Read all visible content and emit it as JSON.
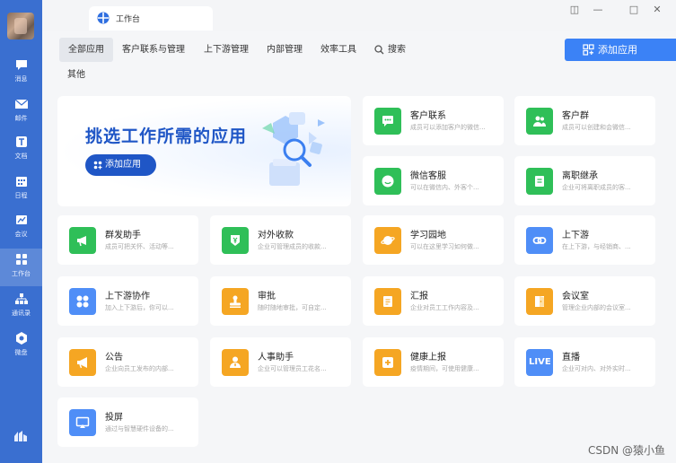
{
  "sidebar": {
    "items": [
      {
        "label": "消息",
        "icon": "chat-icon"
      },
      {
        "label": "邮件",
        "icon": "mail-icon"
      },
      {
        "label": "文档",
        "icon": "doc-icon"
      },
      {
        "label": "日程",
        "icon": "calendar-icon"
      },
      {
        "label": "会议",
        "icon": "meeting-icon"
      },
      {
        "label": "工作台",
        "icon": "grid-icon"
      },
      {
        "label": "通讯录",
        "icon": "contacts-icon"
      },
      {
        "label": "微盘",
        "icon": "drive-icon"
      }
    ],
    "active_index": 5
  },
  "topbar": {
    "tab_label": "工作台"
  },
  "categories": {
    "items": [
      "全部应用",
      "客户联系与管理",
      "上下游管理",
      "内部管理",
      "效率工具",
      "搜索"
    ],
    "other": "其他"
  },
  "add_button": {
    "label": "添加应用"
  },
  "banner": {
    "title": "挑选工作所需的应用",
    "button": "添加应用"
  },
  "apps": [
    {
      "name": "客户联系",
      "desc": "成员可以添加客户的微信...",
      "color": "#2fbf58",
      "icon": "chat-bubble-icon"
    },
    {
      "name": "客户群",
      "desc": "成员可以创建和会微信...",
      "color": "#2fbf58",
      "icon": "people-icon"
    },
    {
      "name": "微信客服",
      "desc": "可以在微信内、外客个...",
      "color": "#2fbf58",
      "icon": "service-icon"
    },
    {
      "name": "离职继承",
      "desc": "企业可将离职成员的客...",
      "color": "#2fbf58",
      "icon": "handover-icon"
    },
    {
      "name": "群发助手",
      "desc": "成员可把关怀、活动等...",
      "color": "#2fbf58",
      "icon": "megaphone-icon"
    },
    {
      "name": "对外收款",
      "desc": "企业可管理成员的收款...",
      "color": "#2fbf58",
      "icon": "yen-icon"
    },
    {
      "name": "学习园地",
      "desc": "可以在这里学习如何做...",
      "color": "#f5a623",
      "icon": "planet-icon"
    },
    {
      "name": "上下游",
      "desc": "在上下游，与经销商、...",
      "color": "#4f8ef7",
      "icon": "link-icon"
    },
    {
      "name": "上下游协作",
      "desc": "加入上下游后，你可以...",
      "color": "#4f8ef7",
      "icon": "apps-icon"
    },
    {
      "name": "审批",
      "desc": "随时随地审批，可自定...",
      "color": "#f5a623",
      "icon": "stamp-icon"
    },
    {
      "name": "汇报",
      "desc": "企业对员工工作内容及...",
      "color": "#f5a623",
      "icon": "report-icon"
    },
    {
      "name": "会议室",
      "desc": "管理企业内部的会议室...",
      "color": "#f5a623",
      "icon": "door-icon"
    },
    {
      "name": "公告",
      "desc": "企业向员工发布的内部...",
      "color": "#f5a623",
      "icon": "notice-icon"
    },
    {
      "name": "人事助手",
      "desc": "企业可以管理员工花名...",
      "color": "#f5a623",
      "icon": "person-icon"
    },
    {
      "name": "健康上报",
      "desc": "疫情期间，可使用健康...",
      "color": "#f5a623",
      "icon": "health-icon"
    },
    {
      "name": "直播",
      "desc": "企业可对内、对外实时...",
      "color": "#4f8ef7",
      "icon": "live-icon",
      "badge": "LIVE"
    },
    {
      "name": "投屏",
      "desc": "通过与智慧硬件设备的...",
      "color": "#4f8ef7",
      "icon": "cast-icon"
    }
  ],
  "watermark": "CSDN @猿小鱼"
}
